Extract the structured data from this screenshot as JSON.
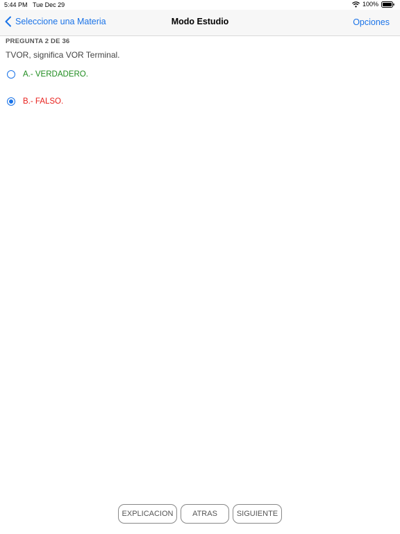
{
  "status_bar": {
    "time": "5:44 PM",
    "date": "Tue Dec 29",
    "battery": "100%"
  },
  "nav": {
    "back_label": "Seleccione una Materia",
    "title": "Modo Estudio",
    "options_label": "Opciones"
  },
  "question": {
    "number": "PREGUNTA 2 DE 36",
    "text": "TVOR, significa VOR Terminal."
  },
  "options": [
    {
      "label": "A.- VERDADERO.",
      "color": "#1e8c1e",
      "selected": false
    },
    {
      "label": "B.- FALSO.",
      "color": "#e8201c",
      "selected": true
    }
  ],
  "buttons": {
    "explanation": "EXPLICACION",
    "back": "ATRAS",
    "next": "SIGUIENTE"
  },
  "colors": {
    "accent": "#1a73e8"
  },
  "icons": {
    "back": "chevron-left-icon",
    "wifi": "wifi-icon",
    "battery": "battery-icon"
  }
}
